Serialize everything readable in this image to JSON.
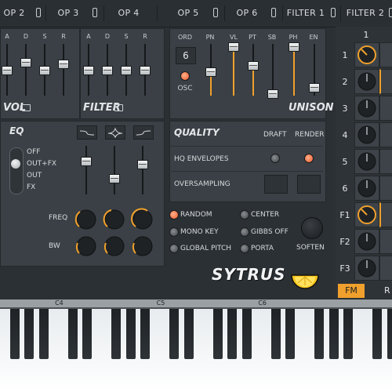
{
  "tabs": [
    "OP 2",
    "OP 3",
    "OP 4",
    "OP 5",
    "OP 6",
    "FILTER 1",
    "FILTER 2"
  ],
  "op_panel": {
    "sliders": [
      "A",
      "D",
      "S",
      "R"
    ],
    "vol_label": "VOL",
    "filter_label": "FILTER"
  },
  "env_panel": {
    "headers": [
      "ORD",
      "PN",
      "VL",
      "PT",
      "SB",
      "PH",
      "EN"
    ],
    "order_value": "6",
    "osc_label": "OSC",
    "unison_label": "UNISON"
  },
  "eq": {
    "title": "EQ",
    "modes": [
      "OFF",
      "OUT+FX",
      "OUT",
      "FX"
    ],
    "freq_label": "FREQ",
    "bw_label": "BW"
  },
  "quality": {
    "title": "QUALITY",
    "draft_label": "DRAFT",
    "render_label": "RENDER",
    "hq_label": "HQ ENVELOPES",
    "oversampling_label": "OVERSAMPLING"
  },
  "options": {
    "random": "RANDOM",
    "mono_key": "MONO KEY",
    "global_pitch": "GLOBAL PITCH",
    "center": "CENTER",
    "gibbs_off": "GIBBS OFF",
    "porta": "PORTA",
    "soften": "SOFTEN"
  },
  "logo": "SYTRUS",
  "matrix": {
    "col_header": "1",
    "rows": [
      "1",
      "2",
      "3",
      "4",
      "5",
      "6",
      "F1",
      "F2",
      "F3"
    ],
    "fm_tab": "FM",
    "next_tab": "R"
  },
  "piano": {
    "labels": [
      "C4",
      "C5",
      "C6"
    ]
  },
  "colors": {
    "accent": "#f0a02c",
    "led_on": "#f05a2a",
    "panel": "#3a4045"
  }
}
